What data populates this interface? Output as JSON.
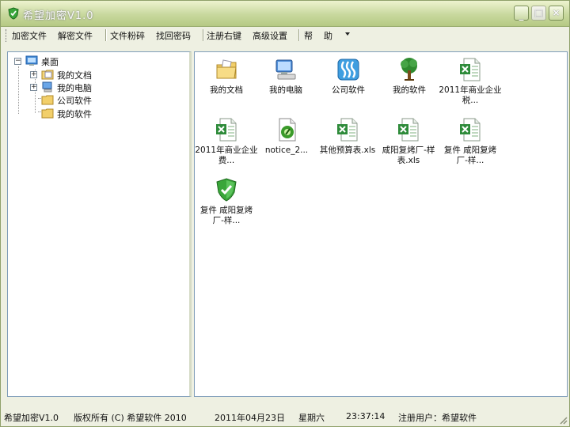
{
  "window": {
    "title": "希望加密V1.0"
  },
  "toolbar": {
    "items": [
      "加密文件",
      "解密文件",
      "文件粉碎",
      "找回密码",
      "注册右键",
      "高级设置",
      "帮",
      "助"
    ]
  },
  "tree": {
    "root": "桌面",
    "children": [
      "我的文档",
      "我的电脑",
      "公司软件",
      "我的软件"
    ]
  },
  "files": [
    {
      "label": "我的文档",
      "icon": "my-documents-icon"
    },
    {
      "label": "我的电脑",
      "icon": "my-computer-icon"
    },
    {
      "label": "公司软件",
      "icon": "folder-company-icon"
    },
    {
      "label": "我的软件",
      "icon": "tree-folder-icon"
    },
    {
      "label": "2011年商业企业税...",
      "icon": "excel-file-icon"
    },
    {
      "label": "2011年商业企业费...",
      "icon": "excel-file-icon"
    },
    {
      "label": "notice_2...",
      "icon": "media-file-icon"
    },
    {
      "label": "其他预算表.xls",
      "icon": "excel-file-icon"
    },
    {
      "label": "咸阳复烤厂-样表.xls",
      "icon": "excel-file-icon"
    },
    {
      "label": "复件 咸阳复烤厂-样...",
      "icon": "excel-file-icon"
    },
    {
      "label": "复件 咸阳复烤厂-样...",
      "icon": "shield-file-icon"
    }
  ],
  "status": {
    "app": "希望加密V1.0",
    "copyright": "版权所有 (C) 希望软件 2010",
    "date": "2011年04月23日",
    "weekday": "星期六",
    "time": "23:37:14",
    "user": "注册用户：希望软件"
  },
  "colors": {
    "chrome": "#c8d89e",
    "excel_green": "#2e8b3a",
    "folder_yellow": "#f2cf6a",
    "shield_green": "#3aa63a"
  }
}
